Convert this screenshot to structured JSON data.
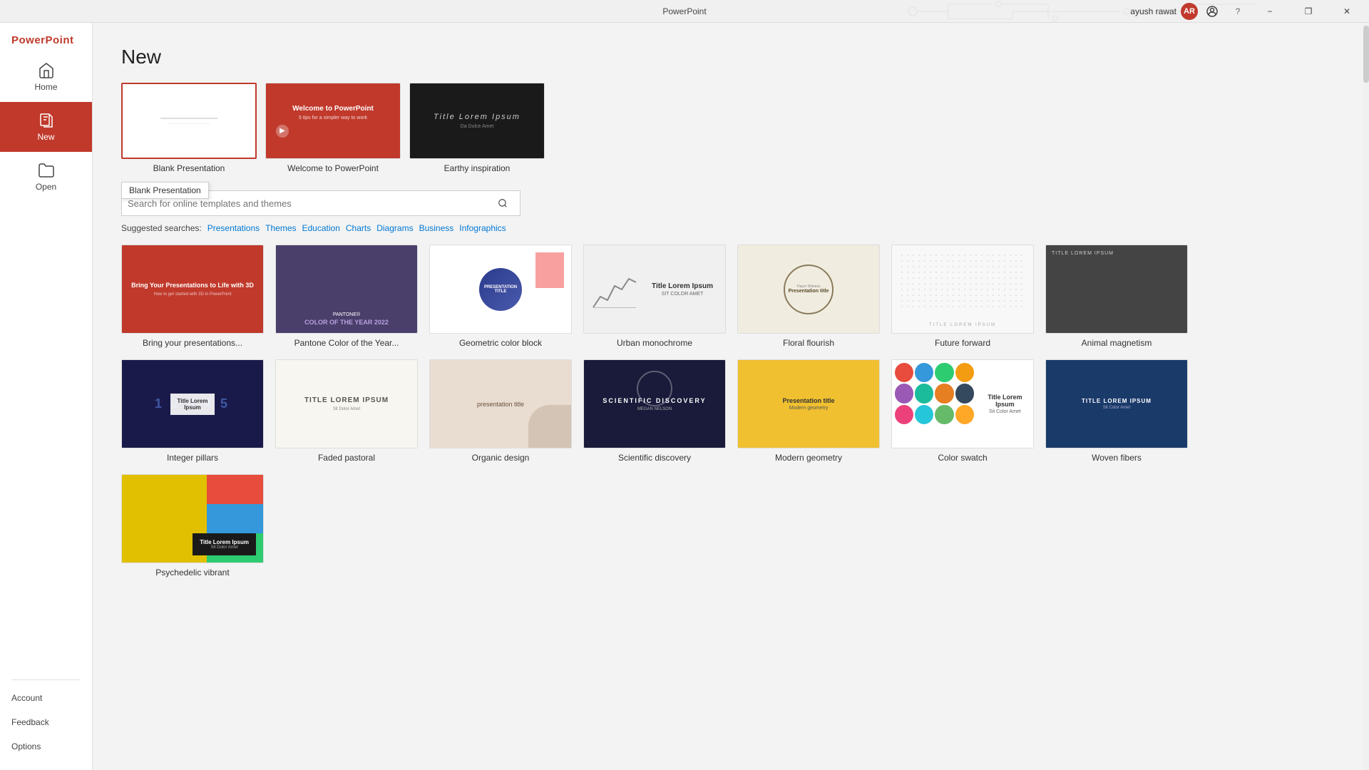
{
  "app": {
    "title": "PowerPoint",
    "user": {
      "name": "ayush rawat",
      "avatar_initials": "AR"
    }
  },
  "titlebar": {
    "minimize_label": "−",
    "restore_label": "❐",
    "close_label": "✕",
    "help_label": "?"
  },
  "sidebar": {
    "brand": "PowerPoint",
    "items": [
      {
        "id": "home",
        "label": "Home",
        "active": false
      },
      {
        "id": "new",
        "label": "New",
        "active": true
      },
      {
        "id": "open",
        "label": "Open",
        "active": false
      }
    ],
    "bottom_items": [
      {
        "id": "account",
        "label": "Account"
      },
      {
        "id": "feedback",
        "label": "Feedback"
      },
      {
        "id": "options",
        "label": "Options"
      }
    ]
  },
  "page": {
    "title": "New"
  },
  "featured_templates": [
    {
      "id": "blank",
      "label": "Blank Presentation",
      "tooltip": "Blank Presentation",
      "selected": true
    },
    {
      "id": "welcome",
      "label": "Welcome to PowerPoint",
      "selected": false
    },
    {
      "id": "earthy",
      "label": "Earthy inspiration",
      "selected": false
    }
  ],
  "search": {
    "placeholder": "Search for online templates and themes",
    "suggested_label": "Suggested searches:",
    "suggestions": [
      "Presentations",
      "Themes",
      "Education",
      "Charts",
      "Diagrams",
      "Business",
      "Infographics"
    ]
  },
  "templates": [
    {
      "id": "bring",
      "label": "Bring your presentations...",
      "text1": "Bring Your Presentations to Life with 3D",
      "text2": "How to get started with 3D in PowerPoint"
    },
    {
      "id": "pantone",
      "label": "Pantone Color of the Year...",
      "text1": "PANTONE®",
      "text2": "COLOR OF THE YEAR 2022"
    },
    {
      "id": "geometric",
      "label": "Geometric color block",
      "text1": "PRESENTATION TITLE"
    },
    {
      "id": "urban",
      "label": "Urban monochrome",
      "text1": "Title Lorem Ipsum",
      "text2": "SIT COLOR AMET"
    },
    {
      "id": "floral",
      "label": "Floral flourish",
      "text1": "Presentation title"
    },
    {
      "id": "future",
      "label": "Future forward",
      "text1": "TITLE LOREM IPSUM"
    },
    {
      "id": "animal",
      "label": "Animal magnetism",
      "text1": "TITLE LOREM IPSUM"
    },
    {
      "id": "integer",
      "label": "Integer pillars",
      "text1": "Title Lorem Ipsum"
    },
    {
      "id": "faded",
      "label": "Faded pastoral",
      "text1": "TITLE LOREM IPSUM"
    },
    {
      "id": "organic",
      "label": "Organic design",
      "text1": "presentation title"
    },
    {
      "id": "scientific",
      "label": "Scientific discovery",
      "text1": "SCIENTIFIC DISCOVERY"
    },
    {
      "id": "modern-geo",
      "label": "Modern geometry",
      "text1": "Presentation title"
    },
    {
      "id": "color-swatch",
      "label": "Color swatch",
      "text1": "Title Lorem Ipsum"
    },
    {
      "id": "woven",
      "label": "Woven fibers",
      "text1": "TITLE LOREM IPSUM"
    },
    {
      "id": "psychedelic",
      "label": "Psychedelic vibrant",
      "text1": "Title Lorem Ipsum"
    }
  ]
}
